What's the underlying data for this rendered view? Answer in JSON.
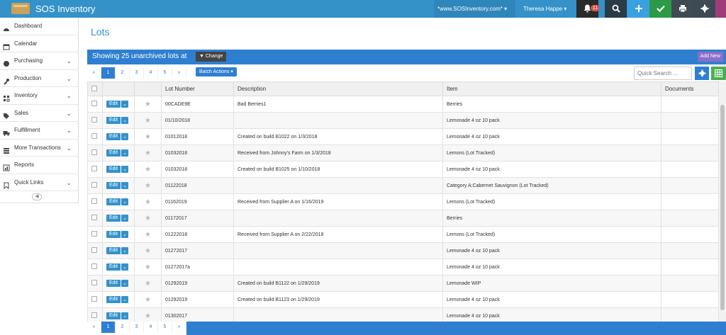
{
  "app": {
    "title": "SOS Inventory"
  },
  "topbar": {
    "site": "*www.SOSInventory.com* ▾",
    "user": "Theresa Happe ▾",
    "notifications_count": "11"
  },
  "sidebar": {
    "items": [
      {
        "label": "Dashboard",
        "icon": "dashboard-icon",
        "has_chevron": false
      },
      {
        "label": "Calendar",
        "icon": "calendar-icon",
        "has_chevron": false
      },
      {
        "label": "Purchasing",
        "icon": "globe-icon",
        "has_chevron": true
      },
      {
        "label": "Production",
        "icon": "wrench-icon",
        "has_chevron": true
      },
      {
        "label": "Inventory",
        "icon": "inventory-icon",
        "has_chevron": true
      },
      {
        "label": "Sales",
        "icon": "tag-icon",
        "has_chevron": true
      },
      {
        "label": "Fulfillment",
        "icon": "truck-icon",
        "has_chevron": true
      },
      {
        "label": "More Transactions",
        "icon": "list-icon",
        "has_chevron": true
      },
      {
        "label": "Reports",
        "icon": "reports-icon",
        "has_chevron": false
      },
      {
        "label": "Quick Links",
        "icon": "bookmark-icon",
        "has_chevron": true
      }
    ],
    "chevron": "⌄",
    "collapse": "◀"
  },
  "page": {
    "title": "Lots"
  },
  "header": {
    "showing": "Showing 25 unarchived lots at",
    "change": "Change",
    "add_new": "Add New"
  },
  "pager": {
    "prev": "«",
    "pages": [
      "1",
      "2",
      "3",
      "4",
      "5"
    ],
    "next": "»"
  },
  "toolbar": {
    "batch_actions": "Batch Actions ▾",
    "search_placeholder": "Quick Search ..."
  },
  "table": {
    "columns": [
      "",
      "",
      "",
      "Lot Number",
      "Description",
      "Item",
      "Documents"
    ],
    "edit_label": "Edit",
    "edit_dd": "⌄",
    "star": "★",
    "rows": [
      {
        "lot": "00CADE9E",
        "desc": "Bad Berries1",
        "item": "Berries"
      },
      {
        "lot": "01/10/2018",
        "desc": "",
        "item": "Lemonade 4 oz 10 pack"
      },
      {
        "lot": "01012018",
        "desc": "Created on build B1022 on 1/3/2018",
        "item": "Lemonade 4 oz 10 pack"
      },
      {
        "lot": "01032018",
        "desc": "Received from Johnny's Farm on 1/3/2018",
        "item": "Lemons (Lot Tracked)"
      },
      {
        "lot": "01032018",
        "desc": "Created on build B1025 on 1/10/2018",
        "item": "Lemonade 4 oz 10 pack"
      },
      {
        "lot": "01122018",
        "desc": "",
        "item": "Category A:Cabernet Sauvignon (Lot Tracked)"
      },
      {
        "lot": "01162019",
        "desc": "Received from Supplier A on 1/16/2019",
        "item": "Lemons (Lot Tracked)"
      },
      {
        "lot": "01172017",
        "desc": "",
        "item": "Berries"
      },
      {
        "lot": "01222018",
        "desc": "Received from Supplier A on 2/22/2018",
        "item": "Lemons (Lot Tracked)"
      },
      {
        "lot": "01272017",
        "desc": "",
        "item": "Lemonade 4 oz 10 pack"
      },
      {
        "lot": "01272017a",
        "desc": "",
        "item": "Lemonade 4 oz 10 pack"
      },
      {
        "lot": "01292019",
        "desc": "Created on build B1122 on 1/29/2019",
        "item": "Lemonade WIP"
      },
      {
        "lot": "01292019",
        "desc": "Created on build B1123 on 1/29/2019",
        "item": "Lemonade 4 oz 10 pack"
      },
      {
        "lot": "01302017",
        "desc": "",
        "item": "Lemonade 4 oz 10 pack"
      }
    ]
  },
  "colors": {
    "brand": "#3592c9",
    "header_bar": "#2f7fd1",
    "add_new": "#8a6fc9",
    "check": "#2c9a46"
  }
}
